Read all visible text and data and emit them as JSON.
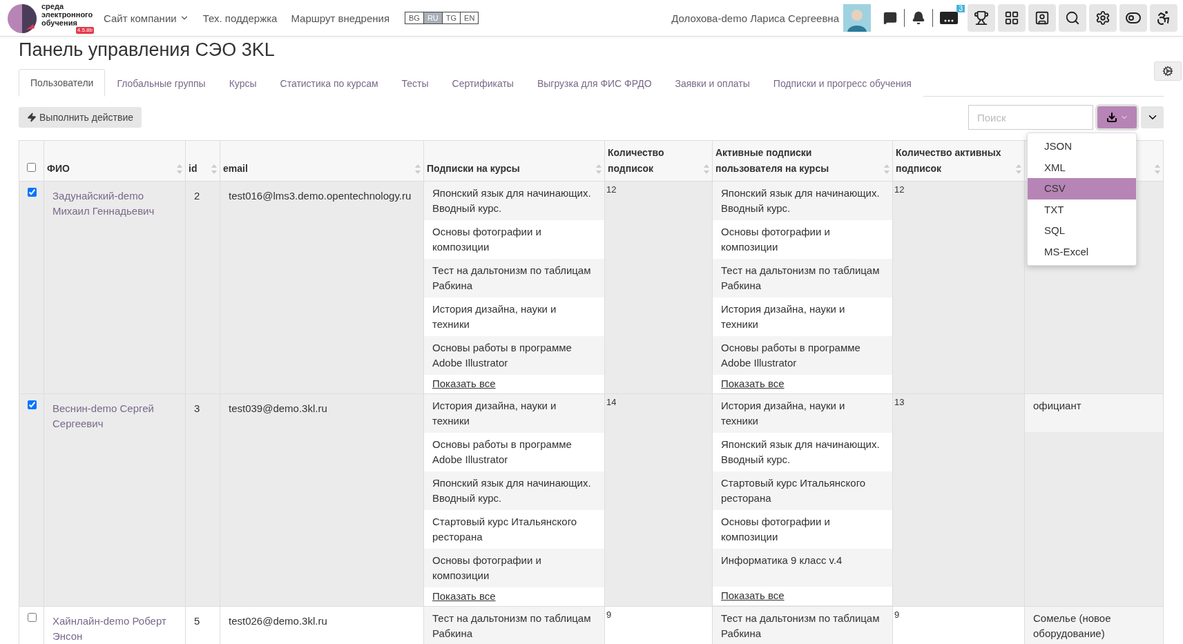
{
  "header": {
    "logo": {
      "text": "среда электронного обучения",
      "version": "4.5.8b"
    },
    "nav": [
      {
        "label": "Сайт компании",
        "dropdown": true
      },
      {
        "label": "Тех. поддержка",
        "dropdown": false
      },
      {
        "label": "Маршрут внедрения",
        "dropdown": false
      }
    ],
    "languages": [
      {
        "label": "BG",
        "selected": false
      },
      {
        "label": "RU",
        "selected": true
      },
      {
        "label": "TG",
        "selected": false
      },
      {
        "label": "EN",
        "selected": false
      }
    ],
    "user": "Долохова-demo Лариса Сергеевна",
    "help_count": "3"
  },
  "title": "Панель управления СЭО 3KL",
  "tabs": [
    {
      "label": "Пользователи",
      "selected": true
    },
    {
      "label": "Глобальные группы",
      "selected": false
    },
    {
      "label": "Курсы",
      "selected": false
    },
    {
      "label": "Статистика по курсам",
      "selected": false
    },
    {
      "label": "Тесты",
      "selected": false
    },
    {
      "label": "Сертификаты",
      "selected": false
    },
    {
      "label": "Выгрузка для ФИС ФРДО",
      "selected": false
    },
    {
      "label": "Заявки и оплаты",
      "selected": false
    },
    {
      "label": "Подписки и прогресс обучения",
      "selected": false
    }
  ],
  "toolbar": {
    "action": "Выполнить действие",
    "search": {
      "placeholder": "Поиск"
    },
    "export_menu": {
      "expanded": true,
      "items": [
        {
          "label": "JSON",
          "selected": false
        },
        {
          "label": "XML",
          "selected": false
        },
        {
          "label": "CSV",
          "selected": true
        },
        {
          "label": "TXT",
          "selected": false
        },
        {
          "label": "SQL",
          "selected": false
        },
        {
          "label": "MS-Excel",
          "selected": false
        }
      ]
    }
  },
  "table": {
    "select_all": {
      "checked": false
    },
    "columns": [
      "ФИО",
      "id",
      "email",
      "Подписки на курсы",
      "Количество подписок",
      "Активные подписки пользователя на курсы",
      "Количество активных подписок"
    ],
    "rows": [
      {
        "checked": true,
        "name": "Задунайский-demo Михаил Геннадьевич",
        "id": "2",
        "email": "test016@lms3.demo.opentechnology.ru",
        "subscriptions": [
          "Японский язык для начинающих. Вводный курс.",
          "Основы фотографии и композиции",
          "Тест на дальтонизм по таблицам Рабкина",
          "История дизайна, науки и техники",
          "Основы работы в программе Adobe Illustrator"
        ],
        "show_all": "Показать все",
        "count": "12",
        "active_subscriptions": [
          "Японский язык для начинающих. Вводный курс.",
          "Основы фотографии и композиции",
          "Тест на дальтонизм по таблицам Рабкина",
          "История дизайна, науки и техники",
          "Основы работы в программе Adobe Illustrator"
        ],
        "active_show_all": "Показать все",
        "active_count": "12"
      },
      {
        "checked": true,
        "name": "Веснин-demo Сергей Сергеевич",
        "id": "3",
        "email": "test039@demo.3kl.ru",
        "subscriptions": [
          "История дизайна, науки и техники",
          "Основы работы в программе Adobe Illustrator",
          "Японский язык для начинающих. Вводный курс.",
          "Стартовый курс Итальянского ресторана",
          "Основы фотографии и композиции"
        ],
        "show_all": "Показать все",
        "count": "14",
        "active_subscriptions": [
          "История дизайна, науки и техники",
          "Японский язык для начинающих. Вводный курс.",
          "Стартовый курс Итальянского ресторана",
          "Основы фотографии и композиции",
          "Информатика 9 класс v.4"
        ],
        "active_show_all": "Показать все",
        "active_count": "13",
        "column_9": "официант"
      },
      {
        "checked": false,
        "name": "Хайнлайн-demo Роберт Энсон",
        "id": "5",
        "email": "test026@demo.3kl.ru",
        "subscriptions": [
          "Тест на дальтонизм по таблицам Рабкина"
        ],
        "count": "9",
        "active_subscriptions": [
          "Тест на дальтонизм по таблицам Рабкина"
        ],
        "active_count": "9",
        "column_9": "Сомелье (новое оборудование)"
      }
    ]
  }
}
